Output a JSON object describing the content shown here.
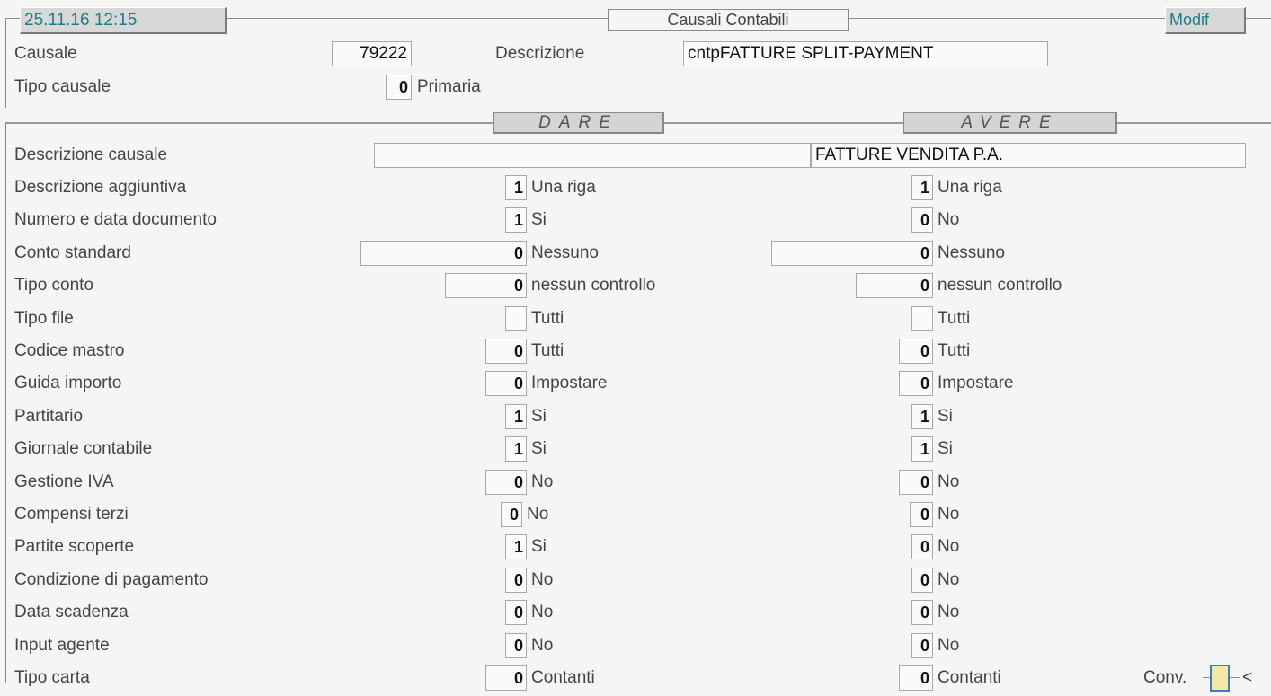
{
  "header": {
    "datetime": "25.11.16 12:15",
    "title": "Causali Contabili",
    "mode": "Modif"
  },
  "top": {
    "causale_label": "Causale",
    "causale_value": "79222",
    "descrizione_label": "Descrizione",
    "descrizione_value": "cntpFATTURE SPLIT-PAYMENT",
    "tipo_label": "Tipo causale",
    "tipo_code": "0",
    "tipo_desc": "Primaria"
  },
  "columns": {
    "dare": "DARE",
    "avere": "AVERE"
  },
  "descrizione_causale": {
    "label": "Descrizione causale",
    "dare": "",
    "avere": "FATTURE VENDITA P.A."
  },
  "rows": [
    {
      "label": "Descrizione aggiuntiva",
      "dare_code": "1",
      "dare_desc": "Una riga",
      "avere_code": "1",
      "avere_desc": "Una riga"
    },
    {
      "label": "Numero e data documento",
      "dare_code": "1",
      "dare_desc": "Si",
      "avere_code": "0",
      "avere_desc": "No"
    },
    {
      "label": "Conto standard",
      "dare_code": "0",
      "dare_desc": "Nessuno",
      "avere_code": "0",
      "avere_desc": "Nessuno"
    },
    {
      "label": "Tipo conto",
      "dare_code": "0",
      "dare_desc": "nessun controllo",
      "avere_code": "0",
      "avere_desc": "nessun controllo"
    },
    {
      "label": "Tipo file",
      "dare_code": "",
      "dare_desc": "Tutti",
      "avere_code": "",
      "avere_desc": "Tutti"
    },
    {
      "label": "Codice mastro",
      "dare_code": "0",
      "dare_desc": "Tutti",
      "avere_code": "0",
      "avere_desc": "Tutti"
    },
    {
      "label": "Guida importo",
      "dare_code": "0",
      "dare_desc": "Impostare",
      "avere_code": "0",
      "avere_desc": "Impostare"
    },
    {
      "label": "Partitario",
      "dare_code": "1",
      "dare_desc": "Si",
      "avere_code": "1",
      "avere_desc": "Si"
    },
    {
      "label": "Giornale contabile",
      "dare_code": "1",
      "dare_desc": "Si",
      "avere_code": "1",
      "avere_desc": "Si"
    },
    {
      "label": "Gestione IVA",
      "dare_code": "0",
      "dare_desc": "No",
      "avere_code": "0",
      "avere_desc": "No"
    },
    {
      "label": "Compensi terzi",
      "dare_code": "0",
      "dare_desc": "No",
      "avere_code": "0",
      "avere_desc": "No"
    },
    {
      "label": "Partite scoperte",
      "dare_code": "1",
      "dare_desc": "Si",
      "avere_code": "0",
      "avere_desc": "No"
    },
    {
      "label": "Condizione di pagamento",
      "dare_code": "0",
      "dare_desc": "No",
      "avere_code": "0",
      "avere_desc": "No"
    },
    {
      "label": "Data scadenza",
      "dare_code": "0",
      "dare_desc": "No",
      "avere_code": "0",
      "avere_desc": "No"
    },
    {
      "label": "Input agente",
      "dare_code": "0",
      "dare_desc": "No",
      "avere_code": "0",
      "avere_desc": "No"
    },
    {
      "label": "Tipo carta",
      "dare_code": "0",
      "dare_desc": "Contanti",
      "avere_code": "0",
      "avere_desc": "Contanti"
    }
  ],
  "footer": {
    "conv_label": "Conv.",
    "arrow": "<"
  },
  "colors": {
    "teal": "#1a7d86",
    "conv_fill": "#f3e7a4",
    "conv_border": "#3a7fc4"
  }
}
